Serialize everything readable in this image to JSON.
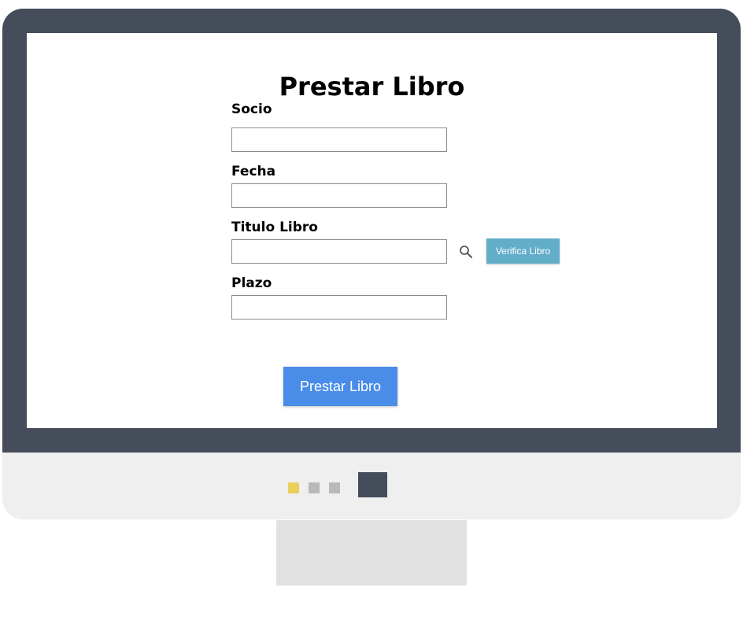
{
  "form": {
    "title": "Prestar Libro",
    "fields": [
      {
        "label": "Socio",
        "value": ""
      },
      {
        "label": "Fecha",
        "value": ""
      },
      {
        "label": "Titulo Libro",
        "value": ""
      },
      {
        "label": "Plazo",
        "value": ""
      }
    ],
    "verify_button": "Verifica Libro",
    "submit_button": "Prestar Libro"
  },
  "icons": {
    "search": "search-icon"
  },
  "colors": {
    "monitor_frame": "#454d5b",
    "verify_button": "#62aec9",
    "submit_button": "#4a8de9",
    "indicator_active": "#e8d05a",
    "indicator_inactive": "#b9b9b9"
  }
}
